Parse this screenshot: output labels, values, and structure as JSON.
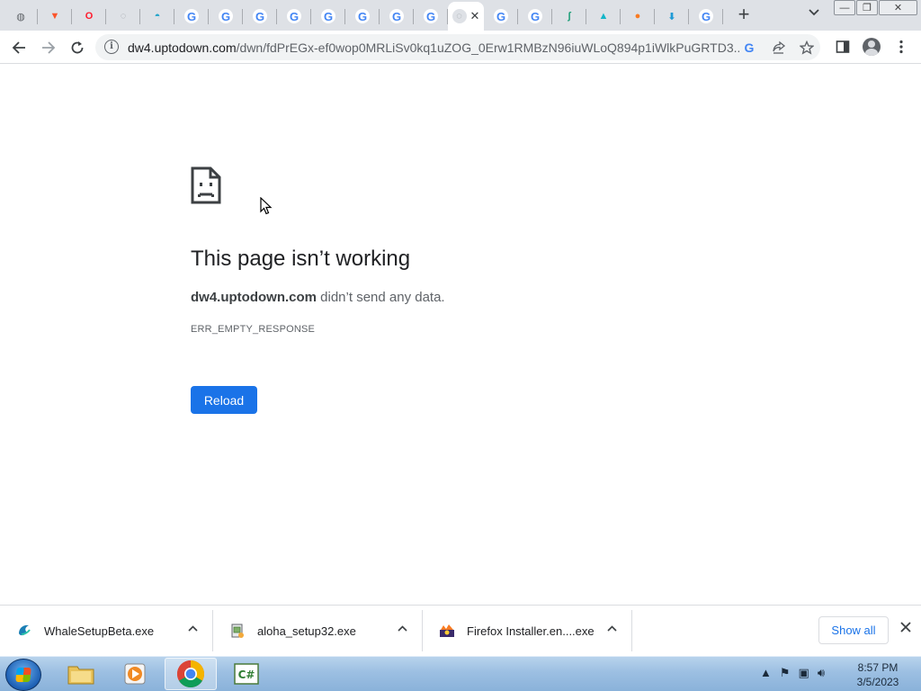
{
  "browser": {
    "tabs": [
      {
        "icon": "globe-icon",
        "title": ""
      },
      {
        "icon": "brave-icon",
        "title": ""
      },
      {
        "icon": "opera-icon",
        "title": ""
      },
      {
        "icon": "loading-icon",
        "title": ""
      },
      {
        "icon": "ghost-icon",
        "title": ""
      },
      {
        "icon": "google-icon",
        "title": ""
      },
      {
        "icon": "google-icon",
        "title": ""
      },
      {
        "icon": "google-icon",
        "title": ""
      },
      {
        "icon": "google-icon",
        "title": ""
      },
      {
        "icon": "google-icon",
        "title": ""
      },
      {
        "icon": "google-icon",
        "title": ""
      },
      {
        "icon": "google-icon",
        "title": ""
      },
      {
        "icon": "google-icon",
        "title": ""
      },
      {
        "icon": "loading-icon",
        "title": "",
        "active": true
      },
      {
        "icon": "google-icon",
        "title": ""
      },
      {
        "icon": "google-icon",
        "title": ""
      },
      {
        "icon": "feather-icon",
        "title": ""
      },
      {
        "icon": "triangle-a-icon",
        "title": ""
      },
      {
        "icon": "firefox-icon",
        "title": ""
      },
      {
        "icon": "download-arrow-icon",
        "title": ""
      },
      {
        "icon": "google-icon",
        "title": ""
      }
    ],
    "active_tab_close": "✕",
    "new_tab_label": "+",
    "tab_list_label": "⌄",
    "window_buttons": {
      "minimize": "—",
      "restore": "❐",
      "close": "✕"
    },
    "url_host": "dw4.uptodown.com",
    "url_path": "/dwn/fdPrEGx-ef0wop0MRLiSv0kq1uZOG_0Erw1RMBzN96iuWLoQ894p1iWlkPuGRTD3..."
  },
  "error_page": {
    "title": "This page isn’t working",
    "host": "dw4.uptodown.com",
    "message_suffix": " didn’t send any data.",
    "code": "ERR_EMPTY_RESPONSE",
    "reload_label": "Reload"
  },
  "downloads": {
    "items": [
      {
        "name": "WhaleSetupBeta.exe",
        "icon": "whale-icon"
      },
      {
        "name": "aloha_setup32.exe",
        "icon": "installer-icon"
      },
      {
        "name": "Firefox Installer.en....exe",
        "icon": "firefox-installer-icon"
      }
    ],
    "show_all_label": "Show all"
  },
  "taskbar": {
    "apps": [
      "explorer-icon",
      "media-player-icon",
      "chrome-icon",
      "csharp-icon"
    ],
    "time": "8:57 PM",
    "date": "3/5/2023"
  },
  "colors": {
    "accent": "#1a73e8",
    "tabstrip": "#dee1e6"
  }
}
